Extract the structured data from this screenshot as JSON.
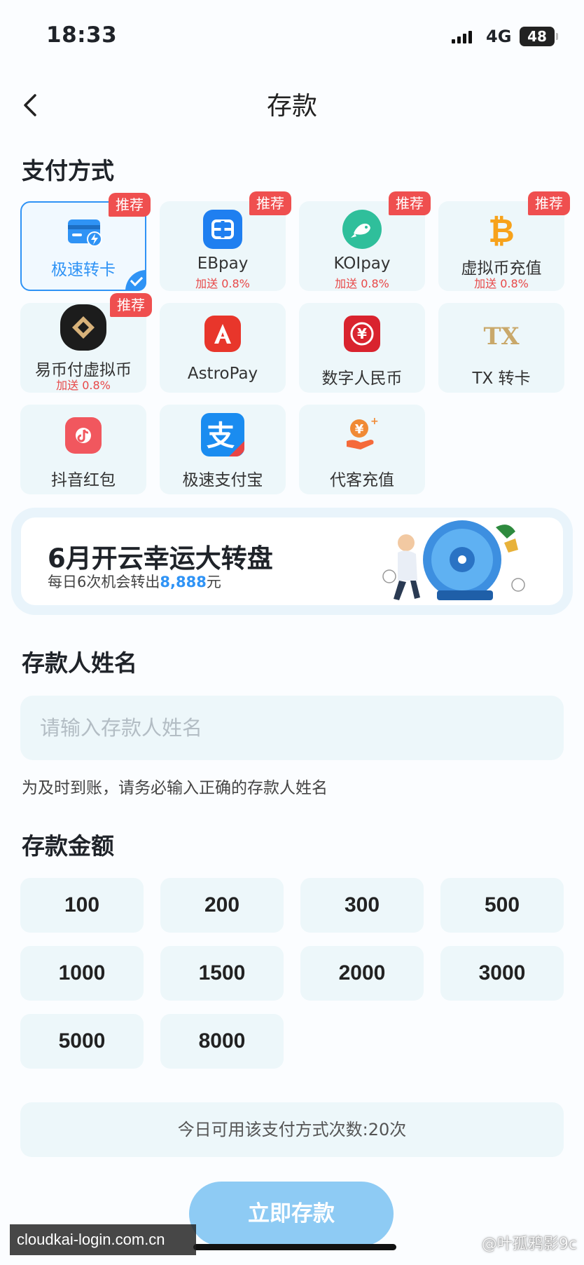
{
  "status_bar": {
    "time": "18:33",
    "network": "4G",
    "battery": "48"
  },
  "header": {
    "title": "存款",
    "back_icon": "chevron-left-icon"
  },
  "payment": {
    "section_title": "支付方式",
    "methods": [
      {
        "label": "极速转卡",
        "bonus": "",
        "badge": "推荐",
        "selected": true,
        "icon": "card-lightning-icon"
      },
      {
        "label": "EBpay",
        "bonus": "加送 0.8%",
        "badge": "推荐",
        "selected": false,
        "icon": "ebpay-icon"
      },
      {
        "label": "KOIpay",
        "bonus": "加送 0.8%",
        "badge": "推荐",
        "selected": false,
        "icon": "koi-fish-icon"
      },
      {
        "label": "虚拟币充值",
        "bonus": "加送 0.8%",
        "badge": "推荐",
        "selected": false,
        "icon": "bitcoin-icon"
      },
      {
        "label": "易币付虚拟币",
        "bonus": "加送 0.8%",
        "badge": "推荐",
        "selected": false,
        "icon": "yibifu-icon"
      },
      {
        "label": "AstroPay",
        "bonus": "",
        "badge": "",
        "selected": false,
        "icon": "astropay-icon"
      },
      {
        "label": "数字人民币",
        "bonus": "",
        "badge": "",
        "selected": false,
        "icon": "digital-rmb-icon"
      },
      {
        "label": "TX 转卡",
        "bonus": "",
        "badge": "",
        "selected": false,
        "icon": "tx-icon"
      },
      {
        "label": "抖音红包",
        "bonus": "",
        "badge": "",
        "selected": false,
        "icon": "douyin-redpacket-icon"
      },
      {
        "label": "极速支付宝",
        "bonus": "",
        "badge": "",
        "selected": false,
        "icon": "alipay-icon"
      },
      {
        "label": "代客充值",
        "bonus": "",
        "badge": "",
        "selected": false,
        "icon": "agent-recharge-icon"
      }
    ]
  },
  "banner": {
    "title": "6月开云幸运大转盘",
    "subtitle_prefix": "每日6次机会转出",
    "amount": "8,888",
    "subtitle_suffix": "元"
  },
  "depositor": {
    "section_title": "存款人姓名",
    "placeholder": "请输入存款人姓名",
    "value": "",
    "hint": "为及时到账，请务必输入正确的存款人姓名"
  },
  "amount": {
    "section_title": "存款金额",
    "options": [
      "100",
      "200",
      "300",
      "500",
      "1000",
      "1500",
      "2000",
      "3000",
      "5000",
      "8000"
    ]
  },
  "quota_text": "今日可用该支付方式次数:20次",
  "submit_label": "立即存款",
  "watermarks": {
    "site": "cloudkai-login.com.cn",
    "author": "@叶孤鸦影9c"
  },
  "colors": {
    "accent": "#2f93f5",
    "badge": "#ef4f4f",
    "card_bg": "#edf7fa",
    "submit": "#8ecbf4"
  }
}
